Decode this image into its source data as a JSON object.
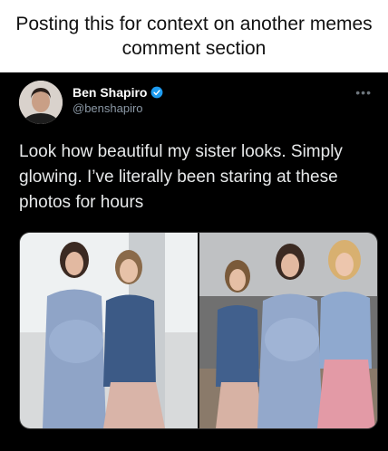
{
  "caption": "Posting this for context on another memes comment section",
  "tweet": {
    "author_name": "Ben Shapiro",
    "handle": "@benshapiro",
    "verified_icon": "verified-badge-icon",
    "more_icon": "more-options-icon",
    "text": "Look how beautiful my sister looks. Simply glowing. I’ve literally been staring at these photos for hours"
  },
  "colors": {
    "background": "#000000",
    "text": "#e7e9ea",
    "secondary": "#8b98a5",
    "verified": "#1d9bf0"
  }
}
